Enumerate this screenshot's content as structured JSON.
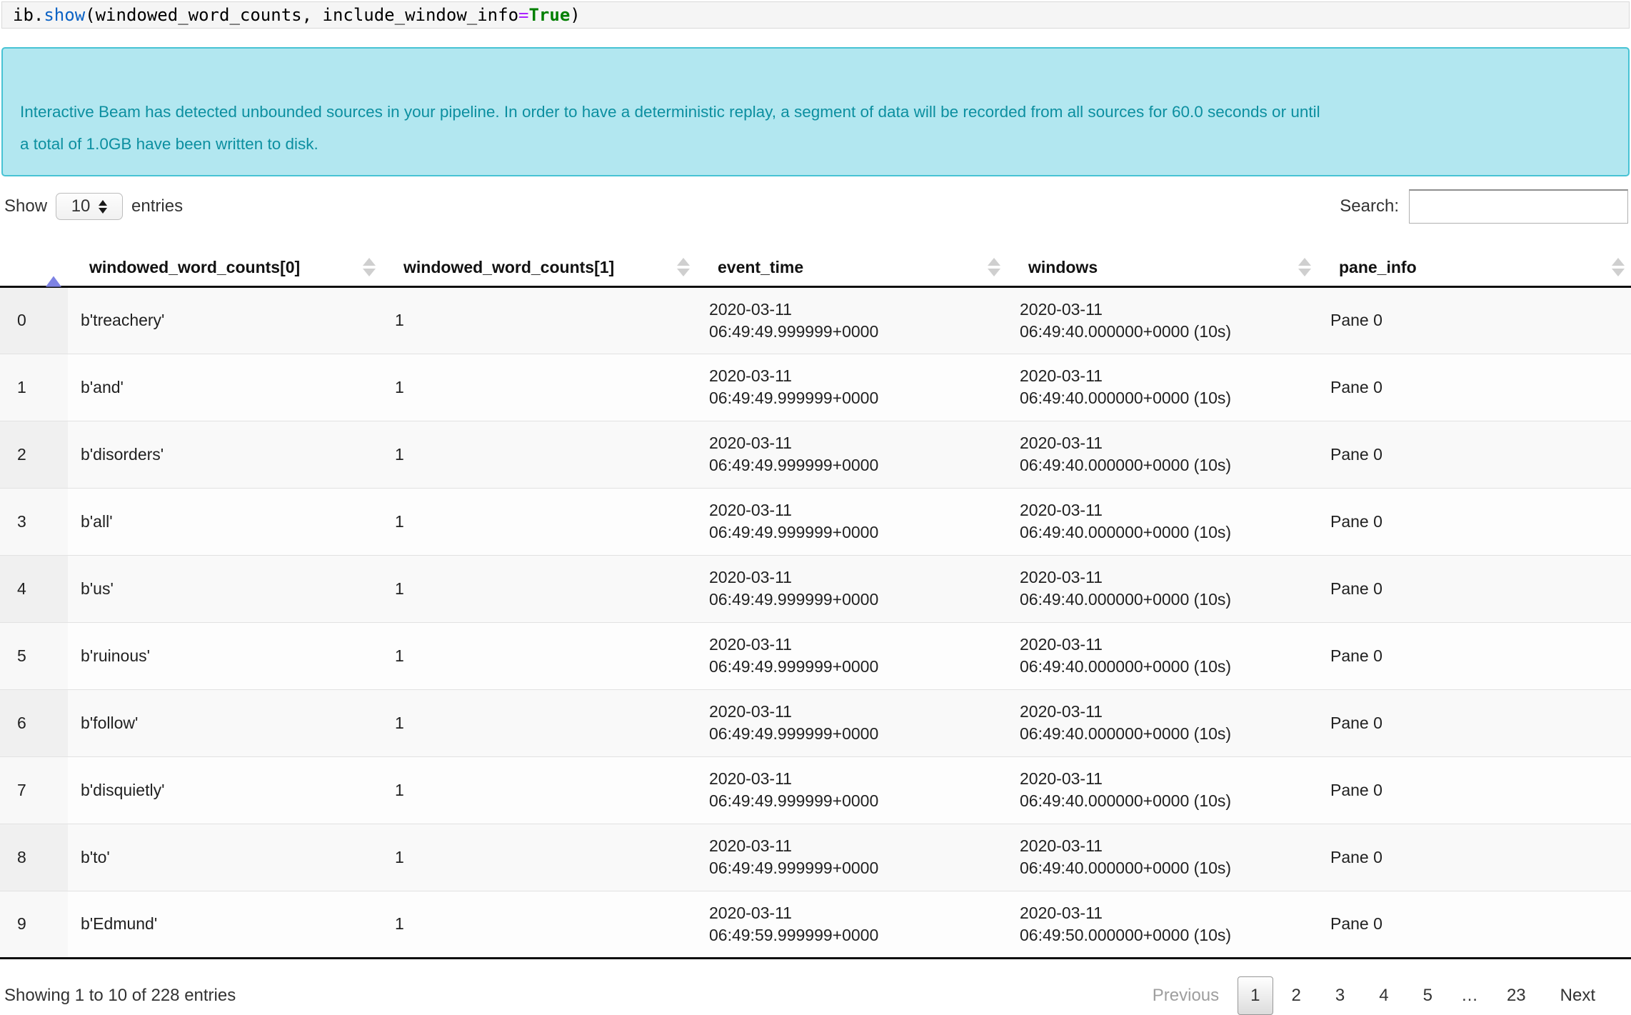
{
  "code_cell": {
    "tokens": {
      "object": "ib.",
      "method": "show",
      "args": "(windowed_word_counts, include_window_info",
      "operator": "=",
      "keyword": "True",
      "close": ")"
    }
  },
  "banner": {
    "text": "Interactive Beam has detected unbounded sources in your pipeline. In order to have a deterministic replay, a segment of data will be recorded from all sources for 60.0 seconds or until\na total of 1.0GB have been written to disk."
  },
  "controls": {
    "show_label": "Show",
    "page_size": "10",
    "entries_label": "entries",
    "search_label": "Search:",
    "search_value": ""
  },
  "table": {
    "columns": [
      "",
      "windowed_word_counts[0]",
      "windowed_word_counts[1]",
      "event_time",
      "windows",
      "pane_info"
    ],
    "sorted_column": 0,
    "sort_direction": "ascending",
    "rows": [
      {
        "index": "0",
        "word": "b'treachery'",
        "count": "1",
        "event_time": "2020-03-11\n06:49:49.999999+0000",
        "windows": "2020-03-11\n06:49:40.000000+0000 (10s)",
        "pane_info": "Pane 0"
      },
      {
        "index": "1",
        "word": "b'and'",
        "count": "1",
        "event_time": "2020-03-11\n06:49:49.999999+0000",
        "windows": "2020-03-11\n06:49:40.000000+0000 (10s)",
        "pane_info": "Pane 0"
      },
      {
        "index": "2",
        "word": "b'disorders'",
        "count": "1",
        "event_time": "2020-03-11\n06:49:49.999999+0000",
        "windows": "2020-03-11\n06:49:40.000000+0000 (10s)",
        "pane_info": "Pane 0"
      },
      {
        "index": "3",
        "word": "b'all'",
        "count": "1",
        "event_time": "2020-03-11\n06:49:49.999999+0000",
        "windows": "2020-03-11\n06:49:40.000000+0000 (10s)",
        "pane_info": "Pane 0"
      },
      {
        "index": "4",
        "word": "b'us'",
        "count": "1",
        "event_time": "2020-03-11\n06:49:49.999999+0000",
        "windows": "2020-03-11\n06:49:40.000000+0000 (10s)",
        "pane_info": "Pane 0"
      },
      {
        "index": "5",
        "word": "b'ruinous'",
        "count": "1",
        "event_time": "2020-03-11\n06:49:49.999999+0000",
        "windows": "2020-03-11\n06:49:40.000000+0000 (10s)",
        "pane_info": "Pane 0"
      },
      {
        "index": "6",
        "word": "b'follow'",
        "count": "1",
        "event_time": "2020-03-11\n06:49:49.999999+0000",
        "windows": "2020-03-11\n06:49:40.000000+0000 (10s)",
        "pane_info": "Pane 0"
      },
      {
        "index": "7",
        "word": "b'disquietly'",
        "count": "1",
        "event_time": "2020-03-11\n06:49:49.999999+0000",
        "windows": "2020-03-11\n06:49:40.000000+0000 (10s)",
        "pane_info": "Pane 0"
      },
      {
        "index": "8",
        "word": "b'to'",
        "count": "1",
        "event_time": "2020-03-11\n06:49:49.999999+0000",
        "windows": "2020-03-11\n06:49:40.000000+0000 (10s)",
        "pane_info": "Pane 0"
      },
      {
        "index": "9",
        "word": "b'Edmund'",
        "count": "1",
        "event_time": "2020-03-11\n06:49:59.999999+0000",
        "windows": "2020-03-11\n06:49:50.000000+0000 (10s)",
        "pane_info": "Pane 0"
      }
    ]
  },
  "footer": {
    "summary": "Showing 1 to 10 of 228 entries",
    "previous_label": "Previous",
    "pages": [
      "1",
      "2",
      "3",
      "4",
      "5",
      "…",
      "23"
    ],
    "current_page": "1",
    "next_label": "Next"
  },
  "colors": {
    "banner_bg": "#b2e7f0",
    "banner_border": "#47c3d4",
    "banner_text": "#0c8fa0",
    "sort_active": "#7d82e4",
    "sort_inactive": "#cfcfcf",
    "code_method": "#0b62c4",
    "code_operator": "#aa22ff",
    "code_keyword": "#007f00"
  }
}
